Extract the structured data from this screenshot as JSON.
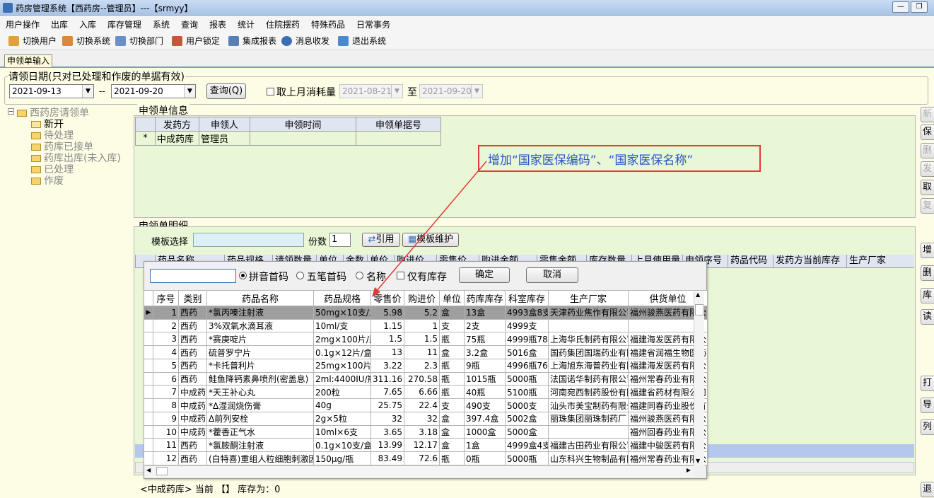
{
  "window": {
    "title": "药房管理系统【西药房--管理员】---【srmyy】",
    "min": "—",
    "max": "❐"
  },
  "menu": [
    "用户操作",
    "出库",
    "入库",
    "库存管理",
    "系统",
    "查询",
    "报表",
    "统计",
    "住院摆药",
    "特殊药品",
    "日常事务"
  ],
  "toolbar": [
    "切换用户",
    "切换系统",
    "切换部门",
    "用户锁定",
    "集成报表",
    "消息收发",
    "退出系统"
  ],
  "tab": "申领单输入",
  "date_group": {
    "legend": "请领日期(只对已处理和作废的单据有效)",
    "from": "2021-09-13",
    "sep": "--",
    "to": "2021-09-20",
    "query_btn": "查询(Q)",
    "prev_month_label": "取上月消耗量",
    "prev_from": "2021-08-21",
    "to_label": "至",
    "prev_to": "2021-09-20"
  },
  "tree": {
    "root": "西药房请领单",
    "items": [
      "新开",
      "待处理",
      "药库已接单",
      "药库出库(未入库)",
      "已处理",
      "作废"
    ]
  },
  "info": {
    "legend": "申领单信息",
    "headers": [
      "发药方",
      "申领人",
      "申领时间",
      "申领单据号"
    ],
    "marker": "*",
    "row": [
      "中成药库",
      "管理员",
      "",
      ""
    ]
  },
  "detail": {
    "legend": "申领单明细",
    "template_label": "模板选择",
    "copies_label": "份数",
    "copies_value": "1",
    "cite_btn": "引用",
    "template_btn": "模板维护",
    "headers": [
      "药品名称",
      "药品规格",
      "请领数量",
      "单位",
      "金数",
      "单价",
      "购进价",
      "零售价",
      "购进金额",
      "零售金额",
      "库存数量",
      "上月使用量",
      "申领序号",
      "药品代码",
      "发药方当前库存",
      "生产厂家"
    ]
  },
  "popup": {
    "search_value": "",
    "radios": [
      "拼音首码",
      "五笔首码",
      "名称"
    ],
    "only_stock": "仅有库存",
    "ok": "确定",
    "cancel": "取消",
    "headers": [
      "序号",
      "类别",
      "药品名称",
      "药品规格",
      "零售价",
      "购进价",
      "单位",
      "药库库存",
      "科室库存",
      "生产厂家",
      "供货单位"
    ],
    "rows": [
      [
        "1",
        "西药",
        "*氯丙嗪注射液",
        "50mg×10支/盒",
        "5.98",
        "5.2",
        "盒",
        "13盒",
        "4993盒8支",
        "天津药业焦作有限公司",
        "福州骏燕医药有限公司"
      ],
      [
        "2",
        "西药",
        "3%双氧水滴耳液",
        "10ml/支",
        "1.15",
        "1",
        "支",
        "2支",
        "4999支",
        "",
        ""
      ],
      [
        "3",
        "西药",
        "*赛庚啶片",
        "2mg×100片/瓶",
        "1.5",
        "1.5",
        "瓶",
        "75瓶",
        "4999瓶78片",
        "上海华氏制药有限公司",
        "福建海发医药有限公司"
      ],
      [
        "4",
        "西药",
        "硫普罗宁片",
        "0.1g×12片/盒",
        "13",
        "11",
        "盒",
        "3.2盒",
        "5016盒",
        "国药集团国瑞药业有限公司",
        "福建省润福生物医药有限公司"
      ],
      [
        "5",
        "西药",
        "*卡托普利片",
        "25mg×100片/瓶",
        "3.22",
        "2.3",
        "瓶",
        "9瓶",
        "4996瓶76片",
        "上海旭东海普药业有限公司",
        "福建海发医药有限公司"
      ],
      [
        "6",
        "西药",
        "鲑鱼降钙素鼻喷剂(密盖息)",
        "2ml:4400IU/瓶",
        "311.16",
        "270.58",
        "瓶",
        "1015瓶",
        "5000瓶",
        "法国诺华制药有限公司",
        "福州常春药业有限公司"
      ],
      [
        "7",
        "中成药",
        "*天王补心丸",
        "200粒",
        "7.65",
        "6.66",
        "瓶",
        "40瓶",
        "5100瓶",
        "河南宛西制药股份有限公司",
        "福建省药材有限公司"
      ],
      [
        "8",
        "中成药",
        "*Δ湿润烧伤膏",
        "40g",
        "25.75",
        "22.4",
        "支",
        "490支",
        "5000支",
        "汕头市美宝制药有限公司",
        "福建同春药业股份有限公司"
      ],
      [
        "9",
        "中成药",
        "Δ前列安栓",
        "2g×5粒",
        "32",
        "32",
        "盒",
        "397.4盒",
        "5002盒",
        "丽珠集团丽珠制药厂",
        "福州骏燕医药有限公司"
      ],
      [
        "10",
        "中成药",
        "*藿香正气水",
        "10ml×6支",
        "3.65",
        "3.18",
        "盒",
        "1000盒",
        "5000盒",
        "",
        "福州回春药业有限公司"
      ],
      [
        "11",
        "西药",
        "*氯胺酮注射液",
        "0.1g×10支/盒",
        "13.99",
        "12.17",
        "盒",
        "1盒",
        "4999盒4支",
        "福建古田药业有限公司",
        "福建中骏医药有限公司"
      ],
      [
        "12",
        "西药",
        "(白特喜)重组人粒细胞刺激因子",
        "150μg/瓶",
        "83.49",
        "72.6",
        "瓶",
        "0瓶",
        "5000瓶",
        "山东科兴生物制品有限公司",
        "福州常春药业有限公司"
      ]
    ]
  },
  "status": {
    "text": "<中成药库> 当前 【】 库存为：0"
  },
  "right_buttons": [
    "新增",
    "保存",
    "删除",
    "发送",
    "取消",
    "复制",
    "增加",
    "删除",
    "库存",
    "读取",
    "打印",
    "导出",
    "列表",
    "退出"
  ],
  "annotation": "增加“国家医保编码”、“国家医保名称”",
  "colors": {
    "content_bg": "#fdfce4",
    "grid_bg": "#e9f7d6",
    "annotation": "#e53935",
    "annotation_text": "#2a56c6"
  }
}
